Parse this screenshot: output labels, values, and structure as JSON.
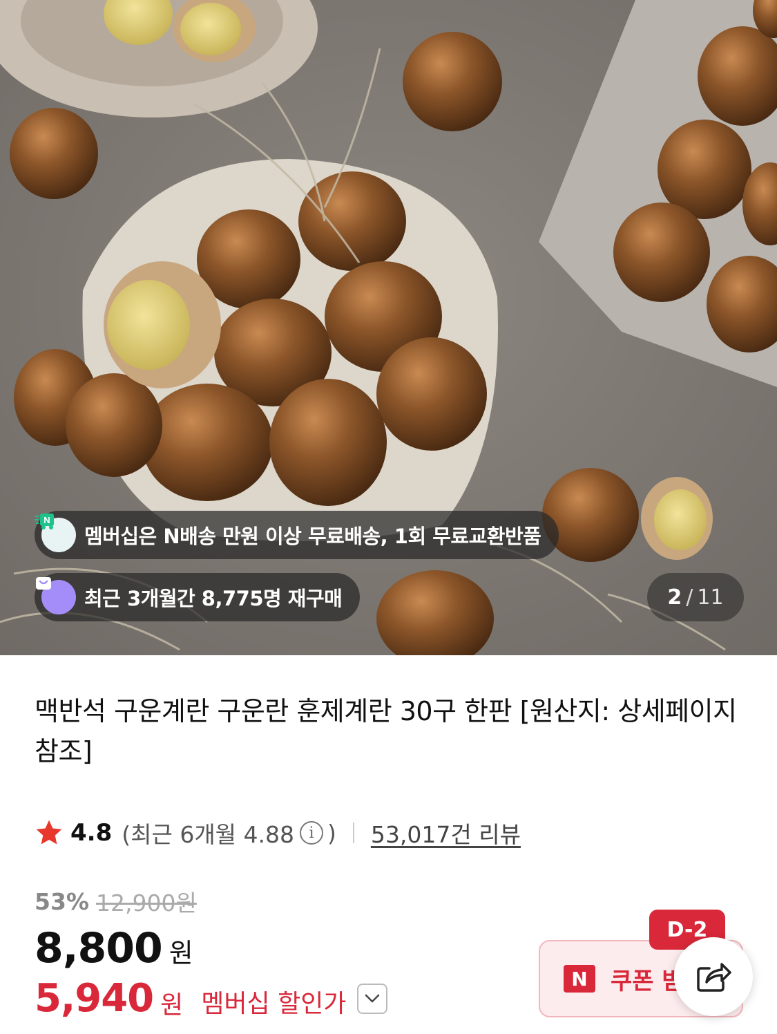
{
  "gallery": {
    "image_alt": "Roasted eggs",
    "badges": {
      "delivery_text": "멤버십은 N배송 만원 이상 무료배송, 1회 무료교환반품",
      "rebuy_text": "최근 3개월간 8,775명 재구매"
    },
    "counter": {
      "current": "2",
      "separator": "/",
      "total": "11"
    }
  },
  "product": {
    "title": "맥반석 구운계란 구운란 훈제계란 30구 한판 [원산지: 상세페이지 참조]",
    "rating": {
      "score": "4.8",
      "recent_prefix": "(최근 6개월 4.88",
      "recent_suffix": ")",
      "review_count_text": "53,017건 리뷰"
    },
    "price": {
      "discount_percent": "53%",
      "original_price": "12,900원",
      "sale_price": "8,800",
      "currency": "원",
      "member_price": "5,940",
      "member_currency": "원",
      "member_label": "멤버십 할인가"
    },
    "coupon": {
      "logo": "N",
      "label": "쿠폰 받기",
      "deadline_badge": "D-2"
    }
  },
  "colors": {
    "accent_red": "#d9283a",
    "star": "#e8382d",
    "overlay_pill": "#282828"
  }
}
